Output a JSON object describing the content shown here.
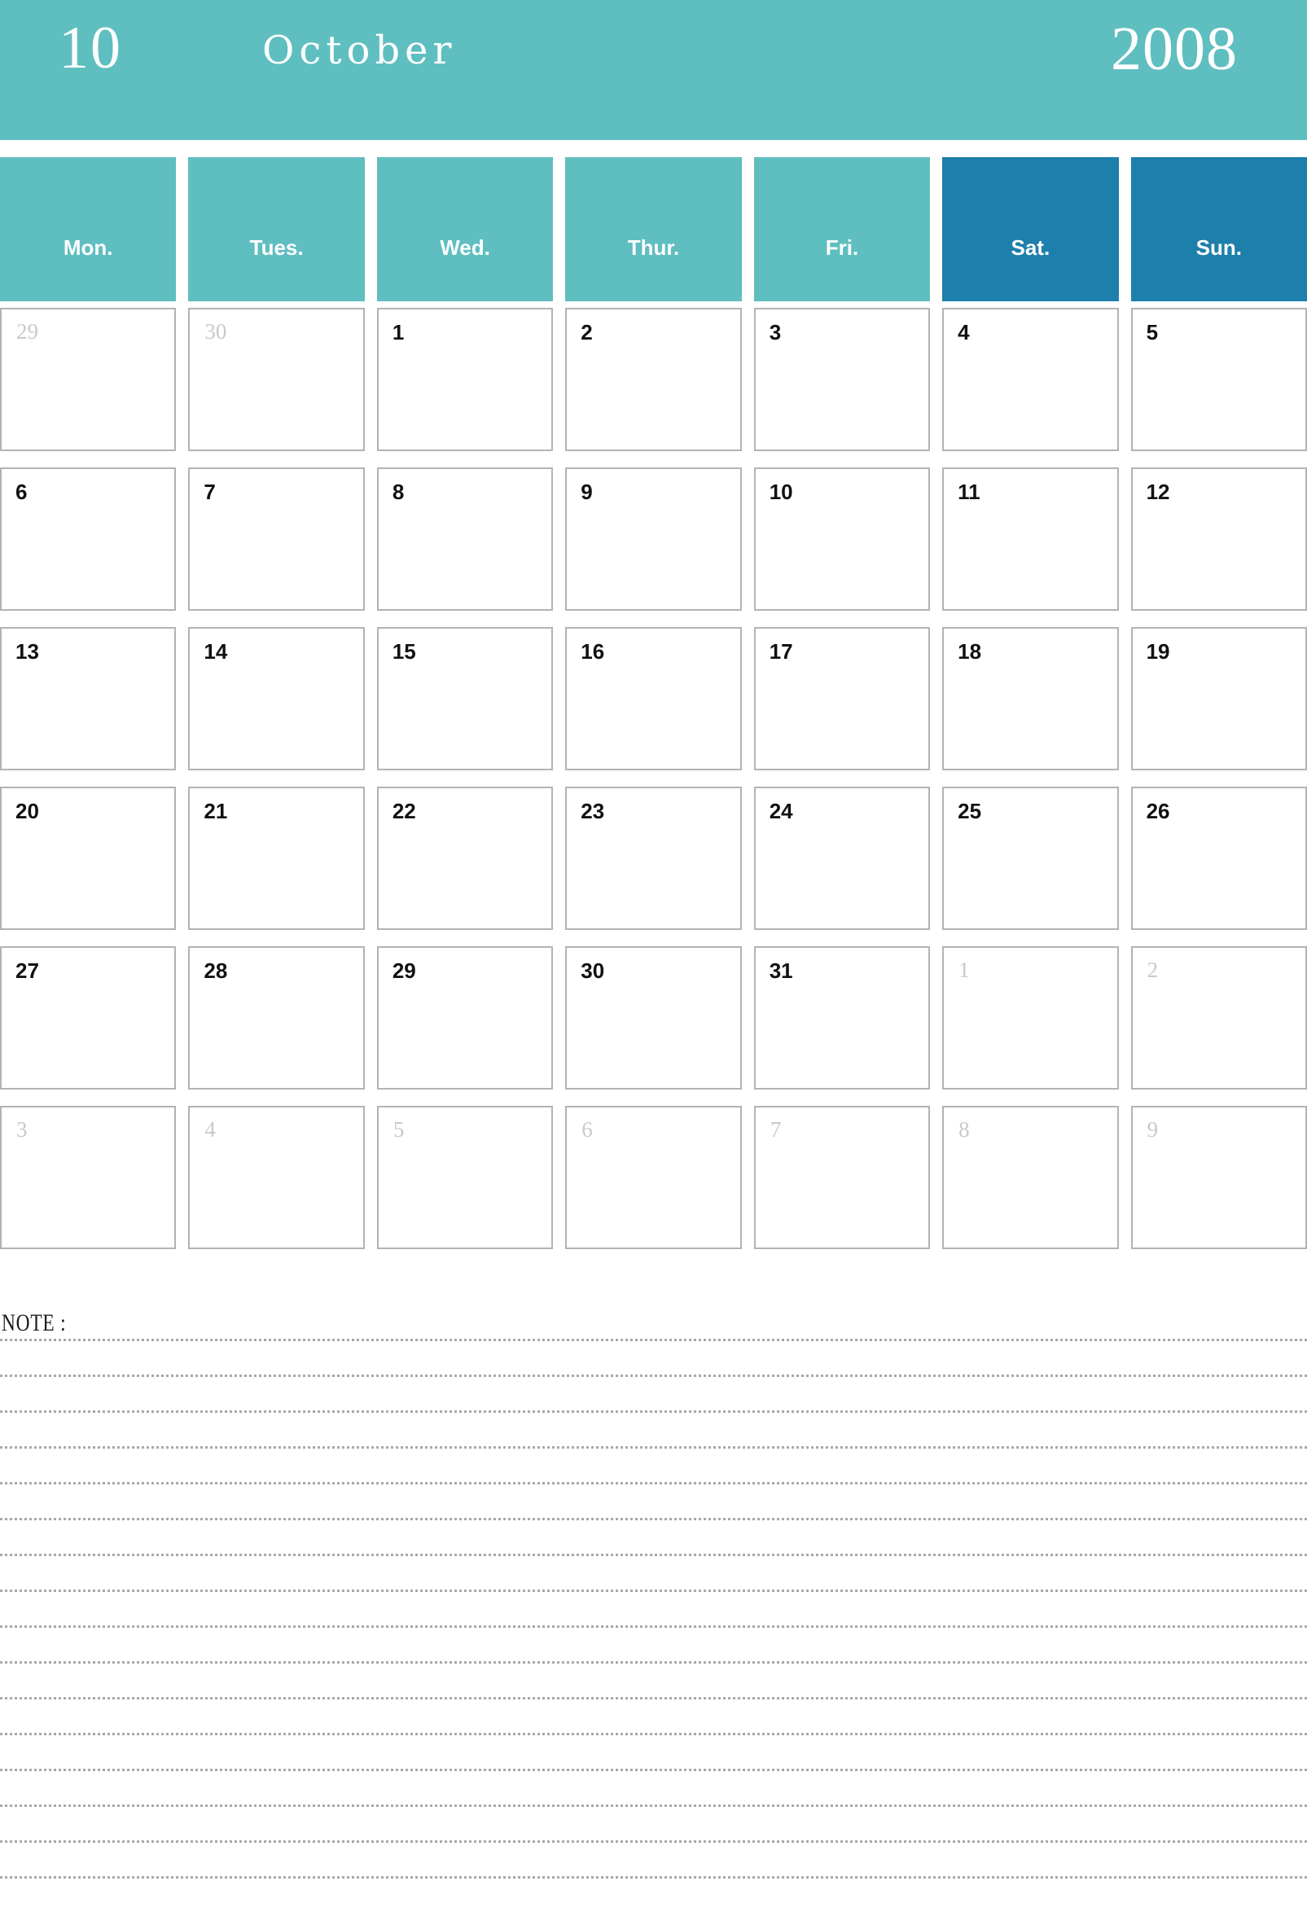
{
  "header": {
    "month_number": "10",
    "month_name": "October",
    "year": "2008",
    "band_color": "#5fbec0",
    "text_color": "#ffffff"
  },
  "weekdays": {
    "accent_weekday_color": "#5fbec0",
    "accent_weekend_color": "#1d7fac",
    "items": [
      {
        "label": "Mon.",
        "weekend": false
      },
      {
        "label": "Tues.",
        "weekend": false
      },
      {
        "label": "Wed.",
        "weekend": false
      },
      {
        "label": "Thur.",
        "weekend": false
      },
      {
        "label": "Fri.",
        "weekend": false
      },
      {
        "label": "Sat.",
        "weekend": true
      },
      {
        "label": "Sun.",
        "weekend": true
      }
    ]
  },
  "grid": {
    "rows": 6,
    "columns": 7,
    "cell_border_color": "#b3b3b3",
    "in_month_color": "#111111",
    "out_of_month_color": "#c9c9c9",
    "cells": [
      {
        "day": "29",
        "in_month": false
      },
      {
        "day": "30",
        "in_month": false
      },
      {
        "day": "1",
        "in_month": true
      },
      {
        "day": "2",
        "in_month": true
      },
      {
        "day": "3",
        "in_month": true
      },
      {
        "day": "4",
        "in_month": true
      },
      {
        "day": "5",
        "in_month": true
      },
      {
        "day": "6",
        "in_month": true
      },
      {
        "day": "7",
        "in_month": true
      },
      {
        "day": "8",
        "in_month": true
      },
      {
        "day": "9",
        "in_month": true
      },
      {
        "day": "10",
        "in_month": true
      },
      {
        "day": "11",
        "in_month": true
      },
      {
        "day": "12",
        "in_month": true
      },
      {
        "day": "13",
        "in_month": true
      },
      {
        "day": "14",
        "in_month": true
      },
      {
        "day": "15",
        "in_month": true
      },
      {
        "day": "16",
        "in_month": true
      },
      {
        "day": "17",
        "in_month": true
      },
      {
        "day": "18",
        "in_month": true
      },
      {
        "day": "19",
        "in_month": true
      },
      {
        "day": "20",
        "in_month": true
      },
      {
        "day": "21",
        "in_month": true
      },
      {
        "day": "22",
        "in_month": true
      },
      {
        "day": "23",
        "in_month": true
      },
      {
        "day": "24",
        "in_month": true
      },
      {
        "day": "25",
        "in_month": true
      },
      {
        "day": "26",
        "in_month": true
      },
      {
        "day": "27",
        "in_month": true
      },
      {
        "day": "28",
        "in_month": true
      },
      {
        "day": "29",
        "in_month": true
      },
      {
        "day": "30",
        "in_month": true
      },
      {
        "day": "31",
        "in_month": true
      },
      {
        "day": "1",
        "in_month": false
      },
      {
        "day": "2",
        "in_month": false
      },
      {
        "day": "3",
        "in_month": false
      },
      {
        "day": "4",
        "in_month": false
      },
      {
        "day": "5",
        "in_month": false
      },
      {
        "day": "6",
        "in_month": false
      },
      {
        "day": "7",
        "in_month": false
      },
      {
        "day": "8",
        "in_month": false
      },
      {
        "day": "9",
        "in_month": false
      }
    ]
  },
  "note": {
    "label": "NOTE :",
    "line_count": 16,
    "line_color": "#a8a8a8"
  }
}
